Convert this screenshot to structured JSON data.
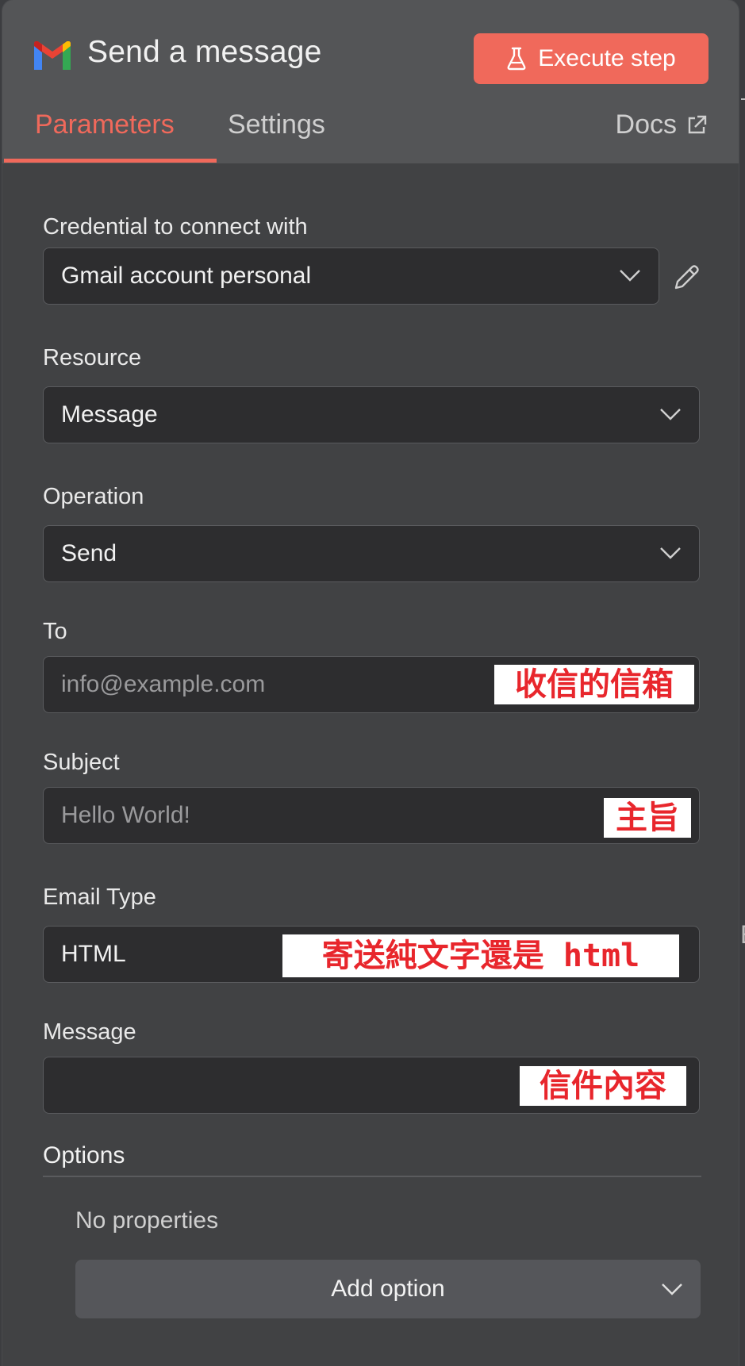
{
  "header": {
    "title": "Send a message",
    "execute_label": "Execute step",
    "tabs": [
      "Parameters",
      "Settings"
    ],
    "docs_label": "Docs"
  },
  "form": {
    "credential": {
      "label": "Credential to connect with",
      "value": "Gmail account personal"
    },
    "resource": {
      "label": "Resource",
      "value": "Message"
    },
    "operation": {
      "label": "Operation",
      "value": "Send"
    },
    "to": {
      "label": "To",
      "placeholder": "info@example.com",
      "annotation": "收信的信箱"
    },
    "subject": {
      "label": "Subject",
      "placeholder": "Hello World!",
      "annotation": "主旨"
    },
    "email_type": {
      "label": "Email Type",
      "value": "HTML",
      "annotation": "寄送純文字還是 html"
    },
    "message": {
      "label": "Message",
      "value": "",
      "annotation": "信件內容"
    }
  },
  "options": {
    "title": "Options",
    "empty_text": "No properties",
    "add_label": "Add option"
  },
  "edge_glyph": "E",
  "colors": {
    "accent": "#f0695b",
    "annotation_text": "#e8262c",
    "field_bg": "#2d2d2f"
  },
  "icons": [
    "gmail-logo-icon",
    "flask-icon",
    "external-link-icon",
    "chevron-down-icon",
    "pencil-icon"
  ]
}
